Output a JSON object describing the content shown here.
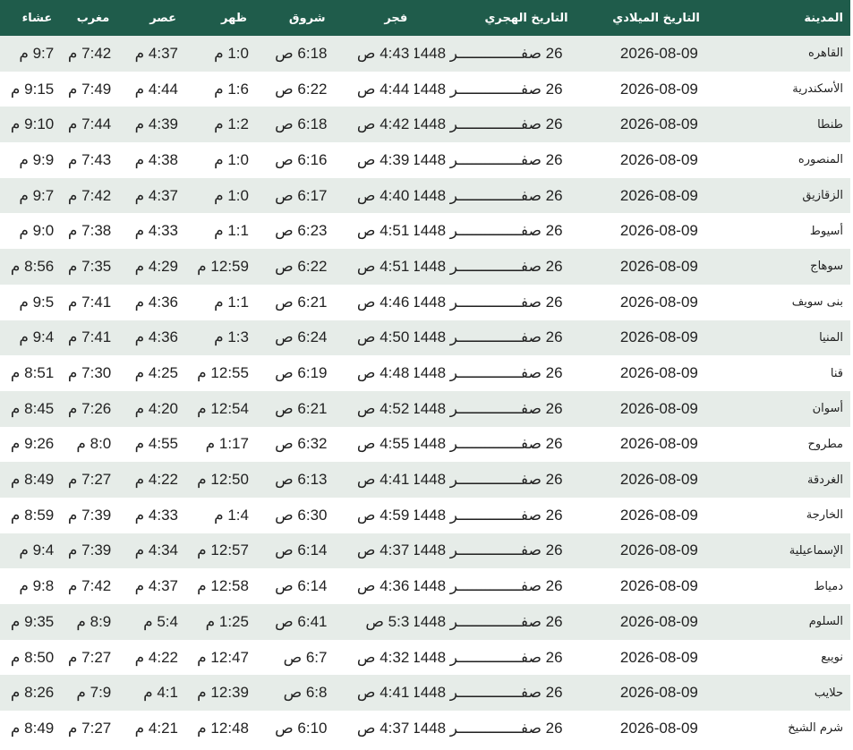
{
  "headers": {
    "city": "المدينة",
    "gregorian": "التاريخ الميلادي",
    "hijri": "التاريخ الهجري",
    "fajr": "فجر",
    "shuruq": "شروق",
    "dhuhr": "ظهر",
    "asr": "عصر",
    "maghrib": "مغرب",
    "isha": "عشاء"
  },
  "rows": [
    {
      "city": "القاهره",
      "gregorian": "2026-08-09",
      "hijri": "26 صفــــــــــــــر 1448",
      "fajr": "4:43 ص",
      "shuruq": "6:18 ص",
      "dhuhr": "1:0 م",
      "asr": "4:37 م",
      "maghrib": "7:42 م",
      "isha": "9:7 م"
    },
    {
      "city": "الأسكندرية",
      "gregorian": "2026-08-09",
      "hijri": "26 صفــــــــــــــر 1448",
      "fajr": "4:44 ص",
      "shuruq": "6:22 ص",
      "dhuhr": "1:6 م",
      "asr": "4:44 م",
      "maghrib": "7:49 م",
      "isha": "9:15 م"
    },
    {
      "city": "طنطا",
      "gregorian": "2026-08-09",
      "hijri": "26 صفــــــــــــــر 1448",
      "fajr": "4:42 ص",
      "shuruq": "6:18 ص",
      "dhuhr": "1:2 م",
      "asr": "4:39 م",
      "maghrib": "7:44 م",
      "isha": "9:10 م"
    },
    {
      "city": "المنصوره",
      "gregorian": "2026-08-09",
      "hijri": "26 صفــــــــــــــر 1448",
      "fajr": "4:39 ص",
      "shuruq": "6:16 ص",
      "dhuhr": "1:0 م",
      "asr": "4:38 م",
      "maghrib": "7:43 م",
      "isha": "9:9 م"
    },
    {
      "city": "الزقازيق",
      "gregorian": "2026-08-09",
      "hijri": "26 صفــــــــــــــر 1448",
      "fajr": "4:40 ص",
      "shuruq": "6:17 ص",
      "dhuhr": "1:0 م",
      "asr": "4:37 م",
      "maghrib": "7:42 م",
      "isha": "9:7 م"
    },
    {
      "city": "أسيوط",
      "gregorian": "2026-08-09",
      "hijri": "26 صفــــــــــــــر 1448",
      "fajr": "4:51 ص",
      "shuruq": "6:23 ص",
      "dhuhr": "1:1 م",
      "asr": "4:33 م",
      "maghrib": "7:38 م",
      "isha": "9:0 م"
    },
    {
      "city": "سوهاج",
      "gregorian": "2026-08-09",
      "hijri": "26 صفــــــــــــــر 1448",
      "fajr": "4:51 ص",
      "shuruq": "6:22 ص",
      "dhuhr": "12:59 م",
      "asr": "4:29 م",
      "maghrib": "7:35 م",
      "isha": "8:56 م"
    },
    {
      "city": "بنى سويف",
      "gregorian": "2026-08-09",
      "hijri": "26 صفــــــــــــــر 1448",
      "fajr": "4:46 ص",
      "shuruq": "6:21 ص",
      "dhuhr": "1:1 م",
      "asr": "4:36 م",
      "maghrib": "7:41 م",
      "isha": "9:5 م"
    },
    {
      "city": "المنيا",
      "gregorian": "2026-08-09",
      "hijri": "26 صفــــــــــــــر 1448",
      "fajr": "4:50 ص",
      "shuruq": "6:24 ص",
      "dhuhr": "1:3 م",
      "asr": "4:36 م",
      "maghrib": "7:41 م",
      "isha": "9:4 م"
    },
    {
      "city": "قنا",
      "gregorian": "2026-08-09",
      "hijri": "26 صفــــــــــــــر 1448",
      "fajr": "4:48 ص",
      "shuruq": "6:19 ص",
      "dhuhr": "12:55 م",
      "asr": "4:25 م",
      "maghrib": "7:30 م",
      "isha": "8:51 م"
    },
    {
      "city": "أسوان",
      "gregorian": "2026-08-09",
      "hijri": "26 صفــــــــــــــر 1448",
      "fajr": "4:52 ص",
      "shuruq": "6:21 ص",
      "dhuhr": "12:54 م",
      "asr": "4:20 م",
      "maghrib": "7:26 م",
      "isha": "8:45 م"
    },
    {
      "city": "مطروح",
      "gregorian": "2026-08-09",
      "hijri": "26 صفــــــــــــــر 1448",
      "fajr": "4:55 ص",
      "shuruq": "6:32 ص",
      "dhuhr": "1:17 م",
      "asr": "4:55 م",
      "maghrib": "8:0 م",
      "isha": "9:26 م"
    },
    {
      "city": "الغردقة",
      "gregorian": "2026-08-09",
      "hijri": "26 صفــــــــــــــر 1448",
      "fajr": "4:41 ص",
      "shuruq": "6:13 ص",
      "dhuhr": "12:50 م",
      "asr": "4:22 م",
      "maghrib": "7:27 م",
      "isha": "8:49 م"
    },
    {
      "city": "الخارجة",
      "gregorian": "2026-08-09",
      "hijri": "26 صفــــــــــــــر 1448",
      "fajr": "4:59 ص",
      "shuruq": "6:30 ص",
      "dhuhr": "1:4 م",
      "asr": "4:33 م",
      "maghrib": "7:39 م",
      "isha": "8:59 م"
    },
    {
      "city": "الإسماعيلية",
      "gregorian": "2026-08-09",
      "hijri": "26 صفــــــــــــــر 1448",
      "fajr": "4:37 ص",
      "shuruq": "6:14 ص",
      "dhuhr": "12:57 م",
      "asr": "4:34 م",
      "maghrib": "7:39 م",
      "isha": "9:4 م"
    },
    {
      "city": "دمياط",
      "gregorian": "2026-08-09",
      "hijri": "26 صفــــــــــــــر 1448",
      "fajr": "4:36 ص",
      "shuruq": "6:14 ص",
      "dhuhr": "12:58 م",
      "asr": "4:37 م",
      "maghrib": "7:42 م",
      "isha": "9:8 م"
    },
    {
      "city": "السلوم",
      "gregorian": "2026-08-09",
      "hijri": "26 صفــــــــــــــر 1448",
      "fajr": "5:3 ص",
      "shuruq": "6:41 ص",
      "dhuhr": "1:25 م",
      "asr": "5:4 م",
      "maghrib": "8:9 م",
      "isha": "9:35 م"
    },
    {
      "city": "نويبع",
      "gregorian": "2026-08-09",
      "hijri": "26 صفــــــــــــــر 1448",
      "fajr": "4:32 ص",
      "shuruq": "6:7 ص",
      "dhuhr": "12:47 م",
      "asr": "4:22 م",
      "maghrib": "7:27 م",
      "isha": "8:50 م"
    },
    {
      "city": "حلايب",
      "gregorian": "2026-08-09",
      "hijri": "26 صفــــــــــــــر 1448",
      "fajr": "4:41 ص",
      "shuruq": "6:8 ص",
      "dhuhr": "12:39 م",
      "asr": "4:1 م",
      "maghrib": "7:9 م",
      "isha": "8:26 م"
    },
    {
      "city": "شرم الشيخ",
      "gregorian": "2026-08-09",
      "hijri": "26 صفــــــــــــــر 1448",
      "fajr": "4:37 ص",
      "shuruq": "6:10 ص",
      "dhuhr": "12:48 م",
      "asr": "4:21 م",
      "maghrib": "7:27 م",
      "isha": "8:49 م"
    }
  ],
  "colors": {
    "header_bg": "#1f5c4b",
    "header_text": "#ffffff",
    "row_alt_bg": "#e6ece8",
    "row_bg": "#ffffff",
    "cell_text": "#222222"
  }
}
